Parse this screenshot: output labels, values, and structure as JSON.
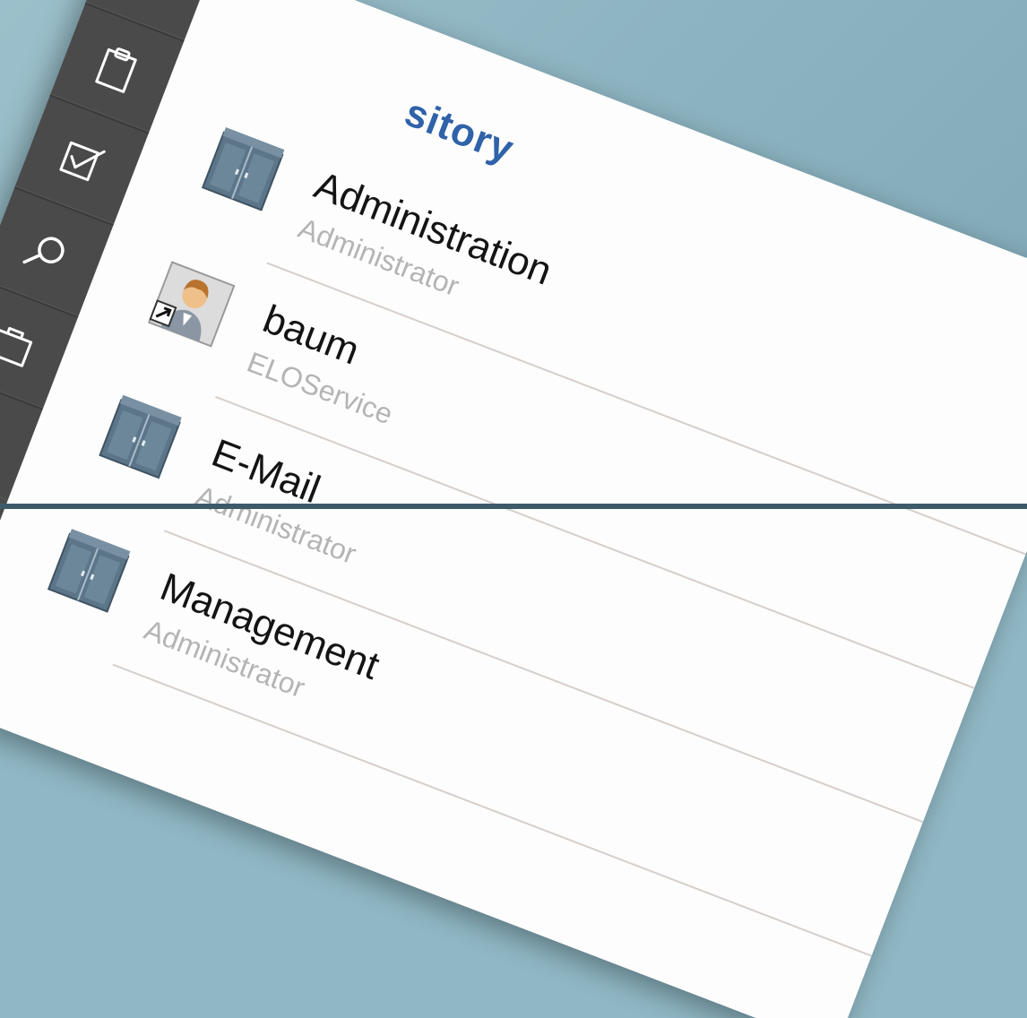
{
  "header": {
    "title": "sitory"
  },
  "sidebar": {
    "items": [
      {
        "name": "inbox-icon"
      },
      {
        "name": "clipboard-icon"
      },
      {
        "name": "task-check-icon"
      },
      {
        "name": "search-icon"
      },
      {
        "name": "briefcase-icon"
      },
      {
        "name": "form-list-icon"
      }
    ]
  },
  "list": {
    "items": [
      {
        "name": "Administration",
        "sub": "Administrator",
        "icon": "cabinet-icon"
      },
      {
        "name": "baum",
        "sub": "ELOService",
        "icon": "user-shortcut-icon"
      },
      {
        "name": "E-Mail",
        "sub": "Administrator",
        "icon": "cabinet-icon"
      },
      {
        "name": "Management",
        "sub": "Administrator",
        "icon": "cabinet-icon"
      }
    ]
  },
  "colors": {
    "background": "#8fb7c4",
    "rail": "#4a4a4a",
    "panel": "#fdfdfd",
    "accent": "#2f62a8",
    "secondary_text": "#b4b4b4"
  }
}
